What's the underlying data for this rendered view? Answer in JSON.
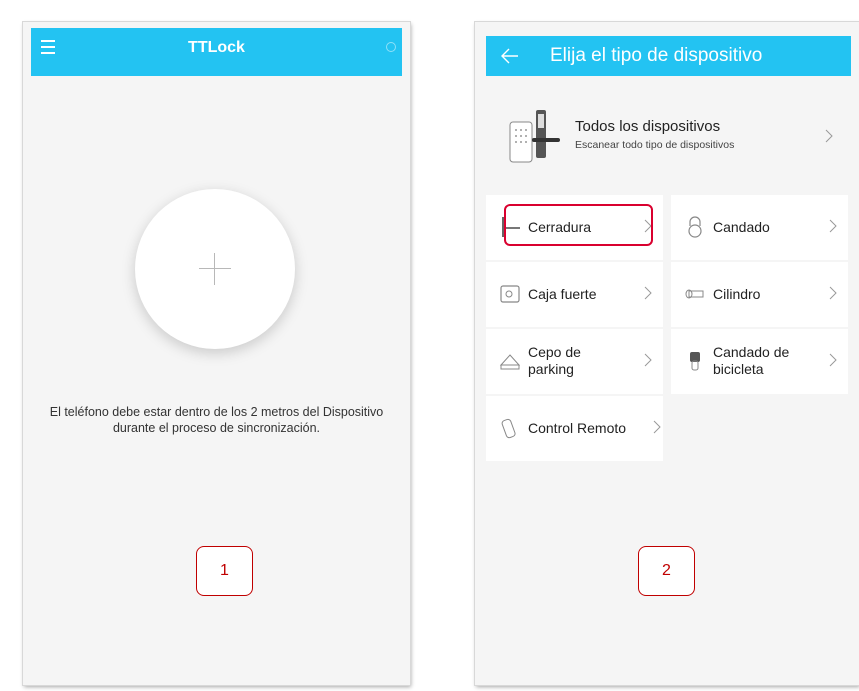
{
  "screen1": {
    "title": "TTLock",
    "hint_line1": "El teléfono debe estar dentro de los 2 metros del Dispositivo",
    "hint_line2": "durante el proceso de sincronización.",
    "marker": "1"
  },
  "screen2": {
    "title": "Elija el tipo de dispositivo",
    "all_devices": {
      "title": "Todos los dispositivos",
      "subtitle": "Escanear todo tipo de dispositivos"
    },
    "tiles": [
      {
        "label": "Cerradura",
        "icon": "door-lock-icon"
      },
      {
        "label": "Candado",
        "icon": "padlock-icon"
      },
      {
        "label": "Caja fuerte",
        "icon": "safe-icon"
      },
      {
        "label": "Cilindro",
        "icon": "cylinder-icon"
      },
      {
        "label_line1": "Cepo de",
        "label_line2": "parking",
        "icon": "parking-lock-icon"
      },
      {
        "label_line1": "Candado de",
        "label_line2": "bicicleta",
        "icon": "bike-lock-icon"
      },
      {
        "label": "Control Remoto",
        "icon": "remote-icon"
      }
    ],
    "marker": "2"
  },
  "colors": {
    "accent": "#23c3f2",
    "highlight": "#d9002f",
    "marker": "#c00000"
  }
}
